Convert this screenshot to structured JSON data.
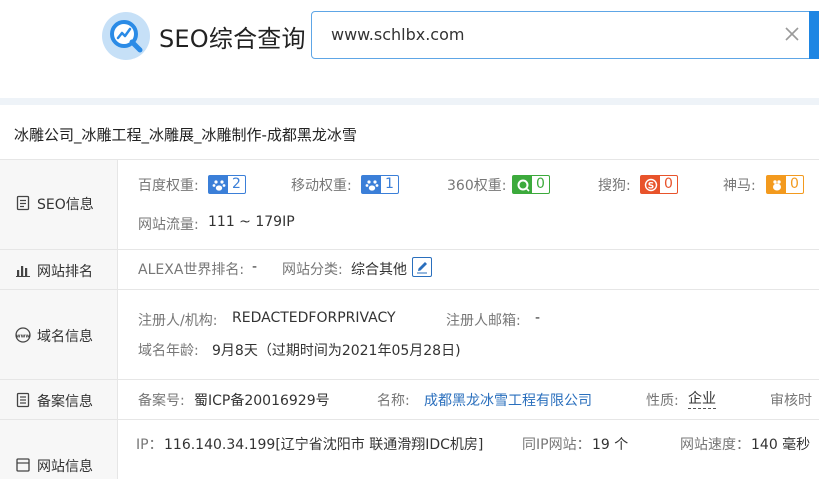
{
  "header": {
    "brand": "SEO综合查询",
    "search_value": "www.schlbx.com"
  },
  "site_title": "冰雕公司_冰雕工程_冰雕展_冰雕制作-成都黑龙冰雪",
  "rows": {
    "seo": {
      "label": "SEO信息",
      "baidu_label": "百度权重:",
      "baidu_value": "2",
      "mobile_label": "移动权重:",
      "mobile_value": "1",
      "so360_label": "360权重:",
      "so360_value": "0",
      "sogou_label": "搜狗:",
      "sogou_value": "0",
      "shenma_label": "神马:",
      "shenma_value": "0",
      "traffic_label": "网站流量:",
      "traffic_value": "111 ~ 179IP"
    },
    "rank": {
      "label": "网站排名",
      "alexa_label": "ALEXA世界排名:",
      "alexa_value": "-",
      "category_label": "网站分类:",
      "category_value": "综合其他"
    },
    "domain": {
      "label": "域名信息",
      "registrant_label": "注册人/机构:",
      "registrant_value": "REDACTEDFORPRIVACY",
      "email_label": "注册人邮箱:",
      "email_value": "-",
      "age_label": "域名年龄:",
      "age_value": "9月8天（过期时间为2021年05月28日)"
    },
    "icp": {
      "label": "备案信息",
      "number_label": "备案号:",
      "number_value": "蜀ICP备20016929号",
      "name_label": "名称:",
      "name_value": "成都黑龙冰雪工程有限公司",
      "nature_label": "性质:",
      "nature_value": "企业",
      "audit_label": "审核时"
    },
    "server": {
      "label": "网站信息",
      "ip_label": "IP：",
      "ip_value": "116.140.34.199[辽宁省沈阳市 联通滑翔IDC机房]",
      "sameip_label": "同IP网站：",
      "sameip_value": "19 个",
      "speed_label": "网站速度：",
      "speed_value": "140 毫秒"
    }
  },
  "colors": {
    "accent": "#1e86e3",
    "baidu": "#3b7fd8",
    "so360": "#3caa3c",
    "sogou": "#e8532b",
    "shenma": "#f39a1e",
    "link": "#2a6fbd"
  }
}
